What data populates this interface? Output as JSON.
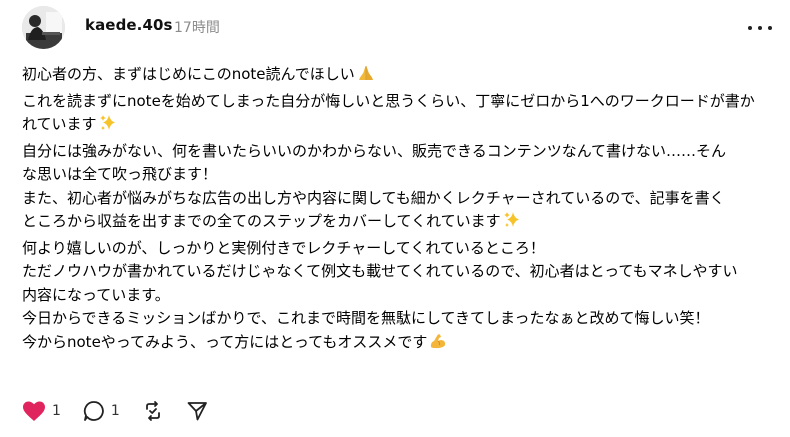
{
  "post": {
    "username": "kaede.40s",
    "time": "17時間",
    "lines": [
      "初心者の方、まずはじめにこのnote読んでほしい",
      "これを読まずにnoteを始めてしまった自分が悔しいと思うくらい、丁寧にゼロから1へのワークロードが書か",
      "れています",
      "自分には強みがない、何を書いたらいいのかわからない、販売できるコンテンツなんて書けない……そん",
      "な思いは全て吹っ飛びます！",
      "また、初心者が悩みがちな広告の出し方や内容に関しても細かくレクチャーされているので、記事を書く",
      "ところから収益を出すまでの全てのステップをカバーしてくれています",
      "何より嬉しいのが、しっかりと実例付きでレクチャーしてくれているところ！",
      "ただノウハウが書かれているだけじゃなくて例文も載せてくれているので、初心者はとってもマネしやすい",
      "内容になっています。",
      "今日からできるミッションばかりで、これまで時間を無駄にしてきてしまったなぁと改めて悔しい笑！",
      "今からnoteやってみよう、って方にはとってもオススメです"
    ],
    "emojis": {
      "line0": "folded-hands-icon",
      "line2": "sparkles-icon",
      "line6": "sparkles-icon",
      "line11": "flexed-biceps-icon"
    }
  },
  "actions": {
    "like_count": "1",
    "reply_count": "1"
  },
  "colors": {
    "like": "#e0245e",
    "text": "#000000",
    "muted": "#8c8c8c",
    "sparkle": "#f6c32a",
    "hands": "#f1b93a"
  }
}
